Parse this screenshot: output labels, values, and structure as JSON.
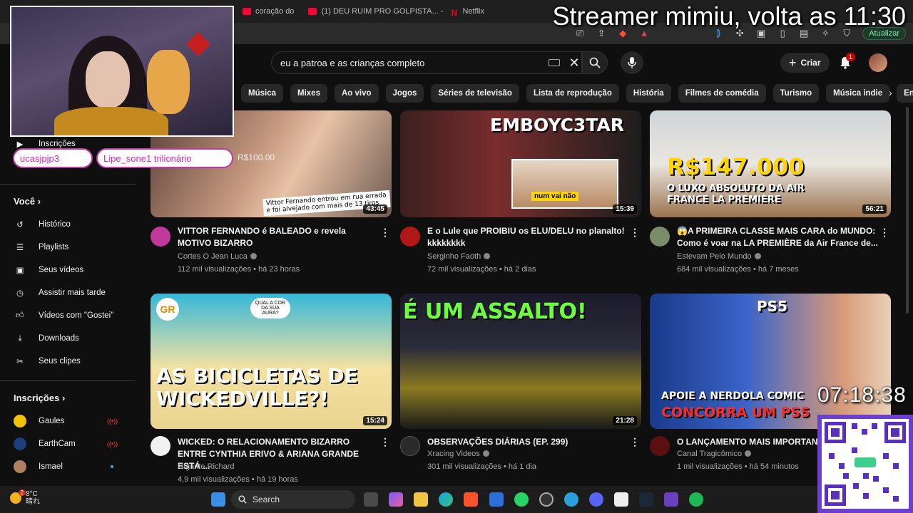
{
  "browser": {
    "tabs": [
      {
        "label": "(1) DEU RUIM PRO GOLPISTA... - You",
        "favicon": "youtube"
      },
      {
        "label": "Netflix",
        "favicon": "netflix"
      }
    ],
    "partial_tab_text": "coração do",
    "update_label": "Atualizar"
  },
  "overlay": {
    "streamer_message": "Streamer mimiu, volta as 11:30",
    "chat": [
      {
        "user": "ucasjpjp3"
      },
      {
        "user": "Lipe_sone1 trilionário"
      }
    ],
    "donation_amount": "R$100.00",
    "clock": "07:18:38"
  },
  "youtube": {
    "search_query": "eu a patroa e as crianças completo",
    "create_label": "Criar",
    "notifications_count": "1",
    "chips": [
      "Música",
      "Mixes",
      "Ao vivo",
      "Jogos",
      "Séries de televisão",
      "Lista de reprodução",
      "História",
      "Filmes de comédia",
      "Turismo",
      "Música indie",
      "Enviados"
    ],
    "sidebar": {
      "subscriptions_top": "Inscrições",
      "you_header": "Você",
      "you_items": [
        {
          "label": "Histórico",
          "icon": "history-icon"
        },
        {
          "label": "Playlists",
          "icon": "playlists-icon"
        },
        {
          "label": "Seus vídeos",
          "icon": "your-videos-icon"
        },
        {
          "label": "Assistir mais tarde",
          "icon": "watch-later-icon"
        },
        {
          "label": "Vídeos com \"Gostei\"",
          "icon": "liked-icon"
        },
        {
          "label": "Downloads",
          "icon": "download-icon"
        },
        {
          "label": "Seus clipes",
          "icon": "clips-icon"
        }
      ],
      "subs_header": "Inscrições",
      "subs": [
        {
          "label": "Gaules",
          "status": "live",
          "color": "#f2c300"
        },
        {
          "label": "EarthCam",
          "status": "live",
          "color": "#1a3f7a"
        },
        {
          "label": "Ismael",
          "status": "new",
          "color": "#b08060"
        }
      ]
    },
    "videos": [
      {
        "title": "VITTOR FERNANDO é BALEADO e revela MOTIVO BIZARRO",
        "channel": "Cortes O Jean Luca",
        "verified": true,
        "stats": "112 mil visualizações • há 23 horas",
        "duration": "43:45",
        "thumb_caption": "Vittor Fernando entrou em rua errada e foi alvejado com mais de 13 tiros",
        "avatar_color": "#c0389b"
      },
      {
        "title": "E o Lule que PROIBIU os ELU/DELU no planalto! kkkkkkkk",
        "channel": "Serginho Faoth",
        "verified": true,
        "stats": "72 mil visualizações • há 2 dias",
        "duration": "15:39",
        "thumb_caption": "EMBOYC3TAR",
        "thumb_caption2": "num vai não",
        "avatar_color": "#b01818"
      },
      {
        "title": "😱A PRIMEIRA CLASSE MAIS CARA do MUNDO: Como é voar na LA PREMIÈRE da Air France de...",
        "channel": "Estevam Pelo Mundo",
        "verified": true,
        "stats": "684 mil visualizações • há 7 meses",
        "duration": "56:21",
        "thumb_caption": "R$147.000",
        "thumb_caption2": "O LUXO ABSOLUTO DA AIR FRANCE LA PREMIÈRE",
        "avatar_color": "#7a8c6a"
      },
      {
        "title": "WICKED: O RELACIONAMENTO BIZARRO ENTRE CYNTHIA ERIVO & ARIANA GRANDE ESTÁ ...",
        "channel": "Gigante Richard",
        "verified": false,
        "stats": "4,9 mil visualizações • há 19 horas",
        "duration": "15:24",
        "thumb_caption": "AS BICICLETAS DE WICKEDVILLE?!",
        "thumb_caption2": "QUAL A COR DA SUA AURA?",
        "avatar_color": "#f1f1f1"
      },
      {
        "title": "OBSERVAÇÕES DIÁRIAS (EP. 299)",
        "channel": "Xracing Videos",
        "verified": true,
        "stats": "301 mil visualizações • há 1 dia",
        "duration": "21:28",
        "thumb_caption": "É UM ASSALTO!",
        "avatar_color": "#2a2a2a"
      },
      {
        "title": "O LANÇAMENTO MAIS IMPORTAN",
        "channel": "Canal Tragicômico",
        "verified": true,
        "stats": "1 mil visualizações • há 54 minutos",
        "duration": "",
        "thumb_caption": "PS5",
        "thumb_caption2": "APOIE A NERDOLA COMIC",
        "thumb_caption3": "CONCORRA UM PS5",
        "avatar_color": "#5a1010"
      }
    ]
  },
  "taskbar": {
    "search_label": "Search",
    "weather_temp": "8°C",
    "weather_desc": "晴れ",
    "weather_badge": "2"
  }
}
